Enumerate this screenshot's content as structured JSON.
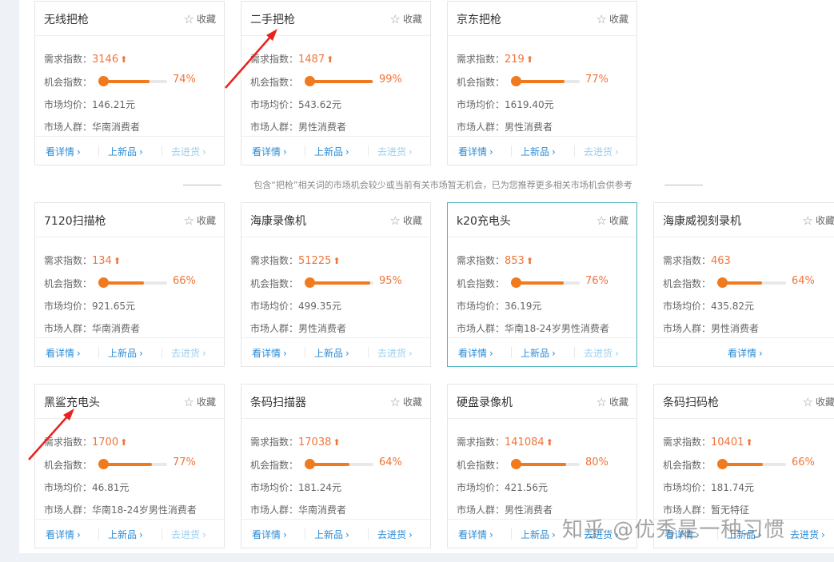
{
  "labels": {
    "demand": "需求指数：",
    "chance": "机会指数：",
    "price": "市场均价：",
    "crowd": "市场人群：",
    "fav": "收藏",
    "detail": "看详情",
    "newprod": "上新品",
    "restock": "去进货"
  },
  "notice": "包含“把枪”相关词的市场机会较少或当前有关市场暂无机会，已为您推荐更多相关市场机会供参考",
  "watermark": "知乎 @优秀是一种习惯",
  "cards": [
    {
      "title": "无线把枪",
      "demand": "3146",
      "up": true,
      "chance_pct": 74,
      "chance": "74%",
      "price": "146.21元",
      "crowd": "华南消费者",
      "restock_enabled": false,
      "active": false
    },
    {
      "title": "二手把枪",
      "demand": "1487",
      "up": true,
      "chance_pct": 99,
      "chance": "99%",
      "price": "543.62元",
      "crowd": "男性消费者",
      "restock_enabled": false,
      "active": false
    },
    {
      "title": "京东把枪",
      "demand": "219",
      "up": true,
      "chance_pct": 77,
      "chance": "77%",
      "price": "1619.40元",
      "crowd": "男性消费者",
      "restock_enabled": false,
      "active": false
    },
    {
      "title": "7120扫描枪",
      "demand": "134",
      "up": true,
      "chance_pct": 66,
      "chance": "66%",
      "price": "921.65元",
      "crowd": "华南消费者",
      "restock_enabled": false,
      "active": false
    },
    {
      "title": "海康录像机",
      "demand": "51225",
      "up": true,
      "chance_pct": 95,
      "chance": "95%",
      "price": "499.35元",
      "crowd": "男性消费者",
      "restock_enabled": false,
      "active": false
    },
    {
      "title": "k20充电头",
      "demand": "853",
      "up": true,
      "chance_pct": 76,
      "chance": "76%",
      "price": "36.19元",
      "crowd": "华南18-24岁男性消费者",
      "restock_enabled": false,
      "active": true
    },
    {
      "title": "海康威视刻录机",
      "demand": "463",
      "up": false,
      "chance_pct": 64,
      "chance": "64%",
      "price": "435.82元",
      "crowd": "男性消费者",
      "restock_enabled": false,
      "active": false,
      "only_detail": true
    },
    {
      "title": "黑鲨充电头",
      "demand": "1700",
      "up": true,
      "chance_pct": 77,
      "chance": "77%",
      "price": "46.81元",
      "crowd": "华南18-24岁男性消费者",
      "restock_enabled": false,
      "active": false
    },
    {
      "title": "条码扫描器",
      "demand": "17038",
      "up": true,
      "chance_pct": 64,
      "chance": "64%",
      "price": "181.24元",
      "crowd": "华南消费者",
      "restock_enabled": true,
      "active": false
    },
    {
      "title": "硬盘录像机",
      "demand": "141084",
      "up": true,
      "chance_pct": 80,
      "chance": "80%",
      "price": "421.56元",
      "crowd": "男性消费者",
      "restock_enabled": true,
      "active": false
    },
    {
      "title": "条码扫码枪",
      "demand": "10401",
      "up": true,
      "chance_pct": 66,
      "chance": "66%",
      "price": "181.74元",
      "crowd": "暂无特征",
      "restock_enabled": true,
      "active": false
    }
  ]
}
